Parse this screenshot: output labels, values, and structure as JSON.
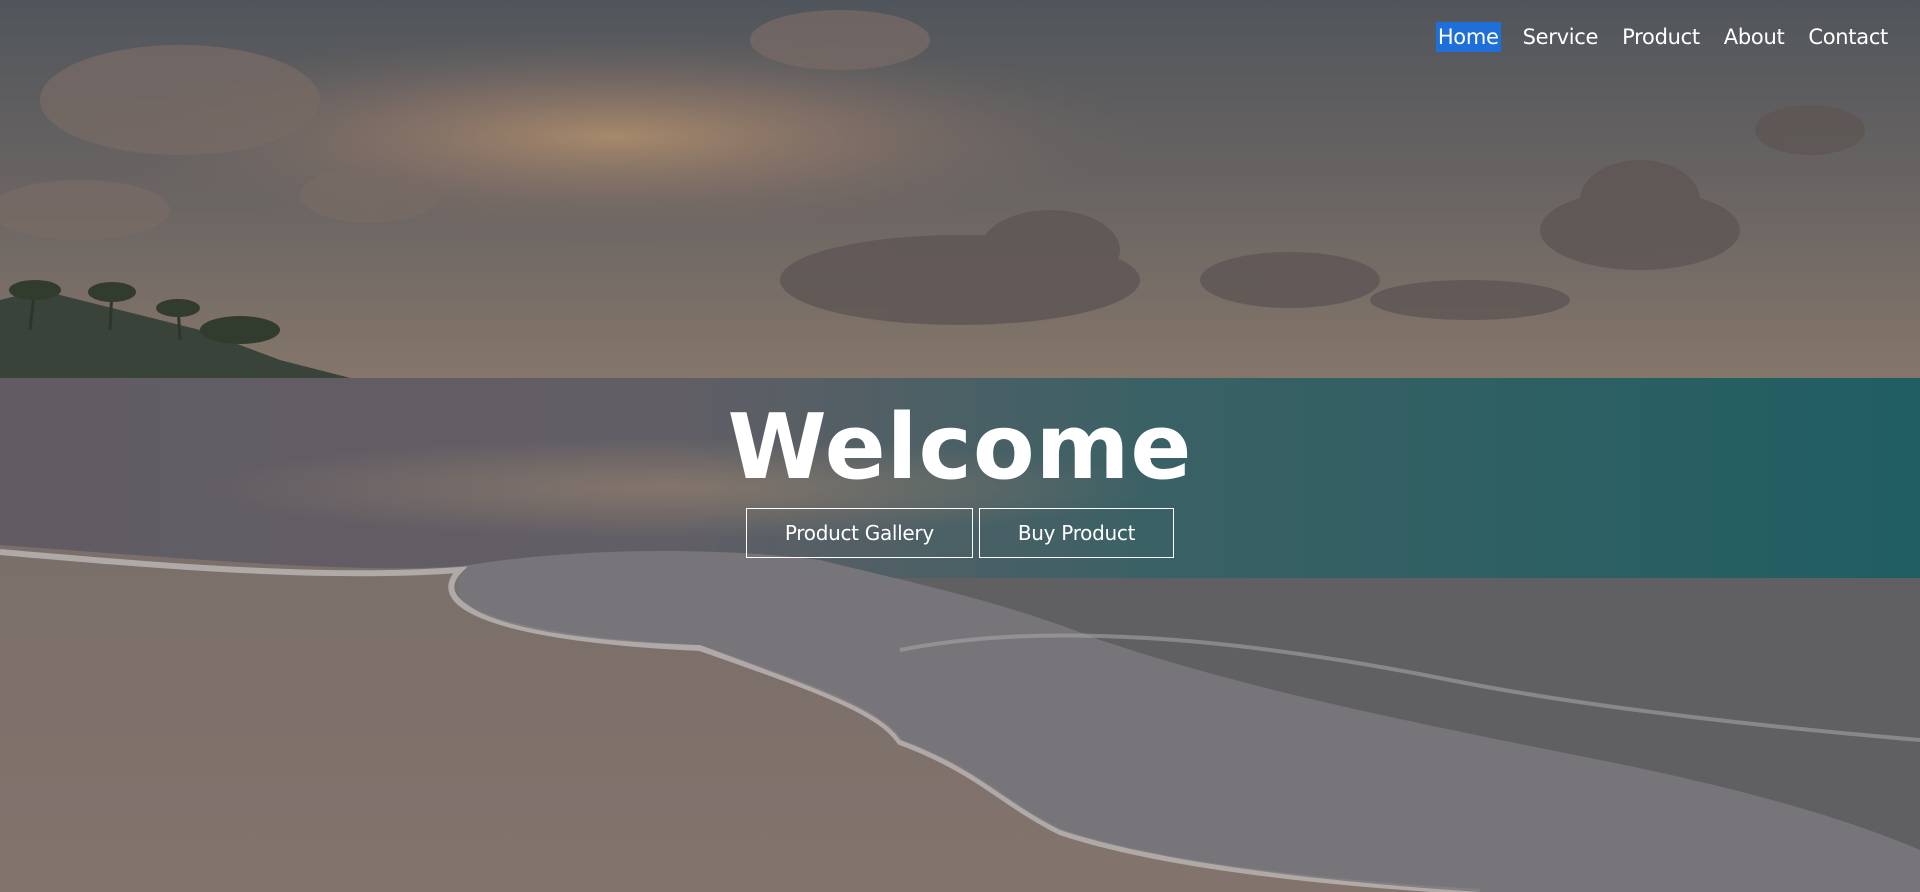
{
  "nav": {
    "items": [
      {
        "label": "Home",
        "active": true
      },
      {
        "label": "Service",
        "active": false
      },
      {
        "label": "Product",
        "active": false
      },
      {
        "label": "About",
        "active": false
      },
      {
        "label": "Contact",
        "active": false
      }
    ]
  },
  "hero": {
    "title": "Welcome",
    "background": "beach-sunset-photo",
    "buttons": {
      "gallery_label": "Product Gallery",
      "buy_label": "Buy Product"
    }
  },
  "colors": {
    "active_nav": "#1e6fd9",
    "text": "#ffffff"
  }
}
